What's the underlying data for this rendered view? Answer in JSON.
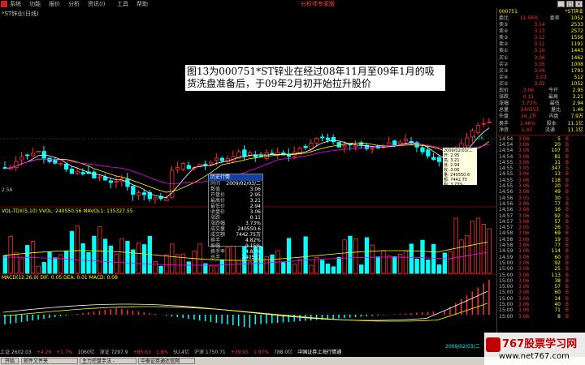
{
  "menubar": {
    "items": [
      "系统",
      "功能",
      "报价",
      "分析",
      "资讯(I)",
      "工具",
      "帮助"
    ],
    "brand": "分析师专家版"
  },
  "chart": {
    "stock_label": "*ST锌业(日线)",
    "ma_label": "MA5 MA10",
    "left_axis_tick": "2.56",
    "price_tag": "3.06",
    "vol_label": "VOL-TDX(5,10) VVOL: 240550.56 MAVOL1: 135327.55",
    "macd_label": "MACD(12,26,9) DIF: 0.05 DEA: 0.01 MACD: 0.08",
    "date_label": "2009/02/03/二"
  },
  "annotation": {
    "text": "图13为000751*ST锌业在经过08年11月至09年1月的吸货洗盘准备后，于09年2月初开始拉升股价"
  },
  "popup": {
    "title": "历史行情",
    "rows": [
      {
        "k": "时间",
        "v": "2009/02/03/二"
      },
      {
        "k": "数值",
        "v": "3.06"
      },
      {
        "k": "开盘价",
        "v": "2.95"
      },
      {
        "k": "最高价",
        "v": "3.21"
      },
      {
        "k": "最低价",
        "v": "2.94"
      },
      {
        "k": "收盘价",
        "v": "3.06"
      },
      {
        "k": "涨跌",
        "v": "0.11"
      },
      {
        "k": "涨跌幅",
        "v": "3.73%"
      },
      {
        "k": "成交量",
        "v": "240550.6"
      },
      {
        "k": "成交额",
        "v": "7442.75万"
      },
      {
        "k": "换手",
        "v": "4.82%"
      },
      {
        "k": "振幅",
        "v": "9.15%"
      },
      {
        "k": "换手率",
        "v": "4.82%"
      },
      {
        "k": "总手",
        "v": "240551"
      }
    ]
  },
  "tooltip": {
    "lines": [
      "2009/02/03/二",
      "开: 2.95",
      "高: 3.21",
      "低: 2.94",
      "收: 3.06",
      "量: 240550.6",
      "额: 7442.75",
      "幅: 3.73%"
    ]
  },
  "right_panel": {
    "code": "000751",
    "name": "*ST锌业",
    "quote_rows": [
      {
        "k": "委比",
        "v": "11.56%",
        "k2": "委差",
        "n": "1052"
      },
      {
        "k": "卖⑤",
        "v": "3.14",
        "n": "2533"
      },
      {
        "k": "卖④",
        "v": "3.13",
        "n": "2572"
      },
      {
        "k": "卖③",
        "v": "3.12",
        "n": "1556"
      },
      {
        "k": "卖②",
        "v": "3.11",
        "n": "1191"
      },
      {
        "k": "卖①",
        "v": "3.10",
        "n": "1443"
      },
      {
        "k": "买①",
        "v": "3.06",
        "n": "1462"
      },
      {
        "k": "买②",
        "v": "3.05",
        "n": "1008"
      },
      {
        "k": "买③",
        "v": "3.04",
        "n": "1791"
      },
      {
        "k": "买④",
        "v": "3.03",
        "n": "512"
      },
      {
        "k": "买⑤",
        "v": "3.02",
        "n": "1052"
      },
      {
        "k": "现价",
        "v": "3.06",
        "k2": "今开",
        "n": "2.95"
      },
      {
        "k": "涨跌",
        "v": "0.11",
        "k2": "最高",
        "n": "3.21"
      },
      {
        "k": "涨幅",
        "v": "3.73%",
        "k2": "最低",
        "n": "2.94"
      },
      {
        "k": "总量",
        "v": "240551",
        "k2": "量比",
        "n": "1.46"
      },
      {
        "k": "外盘",
        "v": "16.2万",
        "k2": "内盘",
        "n": "7.9万"
      },
      {
        "k": "换手",
        "v": "1.46%",
        "k2": "股本",
        "n": "11.1亿"
      },
      {
        "k": "净资",
        "v": "1.45",
        "k2": "流通",
        "n": "11.1亿"
      }
    ],
    "ticks": [
      {
        "t": "14:54",
        "p": "3.06",
        "q": "5",
        "s": "B"
      },
      {
        "t": "14:54",
        "p": "3.06",
        "q": "20",
        "s": "B"
      },
      {
        "t": "14:54",
        "p": "3.06",
        "q": "107",
        "s": "B"
      },
      {
        "t": "14:54",
        "p": "3.06",
        "q": "81",
        "s": "B"
      },
      {
        "t": "14:55",
        "p": "3.06",
        "q": "11",
        "s": "B"
      },
      {
        "t": "14:55",
        "p": "3.05",
        "q": "347",
        "s": "S"
      },
      {
        "t": "14:55",
        "p": "3.06",
        "q": "13",
        "s": "B"
      },
      {
        "t": "14:55",
        "p": "3.06",
        "q": "118",
        "s": "B"
      },
      {
        "t": "14:55",
        "p": "3.06",
        "q": "20",
        "s": "B"
      },
      {
        "t": "14:56",
        "p": "3.06",
        "q": "49",
        "s": "B"
      },
      {
        "t": "14:56",
        "p": "3.05",
        "q": "30",
        "s": "S"
      },
      {
        "t": "14:56",
        "p": "3.06",
        "q": "77",
        "s": "B"
      },
      {
        "t": "14:56",
        "p": "3.06",
        "q": "16",
        "s": "B"
      },
      {
        "t": "14:57",
        "p": "3.06",
        "q": "92",
        "s": "B"
      },
      {
        "t": "14:57",
        "p": "3.06",
        "q": "57",
        "s": "B"
      },
      {
        "t": "14:57",
        "p": "3.05",
        "q": "26",
        "s": "S"
      },
      {
        "t": "14:58",
        "p": "3.06",
        "q": "69",
        "s": "B"
      },
      {
        "t": "14:58",
        "p": "3.06",
        "q": "19",
        "s": "B"
      },
      {
        "t": "14:58",
        "p": "3.06",
        "q": "77",
        "s": "B"
      },
      {
        "t": "14:59",
        "p": "3.06",
        "q": "114",
        "s": "B"
      },
      {
        "t": "14:59",
        "p": "3.06",
        "q": "60",
        "s": "B"
      },
      {
        "t": "15:00",
        "p": "3.06",
        "q": "92",
        "s": "B"
      },
      {
        "t": "15:00",
        "p": "3.06",
        "q": "25",
        "s": "B"
      },
      {
        "t": "15:00",
        "p": "3.06",
        "q": "113",
        "s": "B"
      },
      {
        "t": "15:00",
        "p": "3.06",
        "q": "38",
        "s": "B"
      },
      {
        "t": "15:00",
        "p": "3.06",
        "q": "57",
        "s": "B"
      },
      {
        "t": "15:00",
        "p": "3.06",
        "q": "60",
        "s": "B"
      },
      {
        "t": "15:00",
        "p": "3.06",
        "q": "14",
        "s": "B"
      },
      {
        "t": "15:00",
        "p": "3.06",
        "q": "40",
        "s": "B"
      },
      {
        "t": "15:00",
        "p": "3.06",
        "q": "71",
        "s": "B"
      },
      {
        "t": "15:00",
        "p": "3.06",
        "q": "8",
        "s": "B"
      }
    ]
  },
  "status": {
    "items": [
      "上证 2602.03",
      "+4.26",
      "+1.7%",
      "1060亿",
      "深证 7297.9",
      "+85.63",
      "1.8%",
      "5U.4亿",
      "沪深 1750.71",
      "+39.95",
      "1.97%",
      "788.0亿",
      "中国证券上海行情通"
    ]
  },
  "taskbar": {
    "start": "开始",
    "tasks": [
      "邮件文件夹",
      "主力控盘手法 - ",
      "中泰证券通达信网"
    ]
  },
  "watermark": {
    "big": "767股票学习网",
    "url": "www.net767.com"
  },
  "colors": {
    "up": "#ff3030",
    "down": "#00ffff",
    "ma5": "#ffffff",
    "ma10": "#ffff00",
    "ma20": "#ff00ff"
  }
}
